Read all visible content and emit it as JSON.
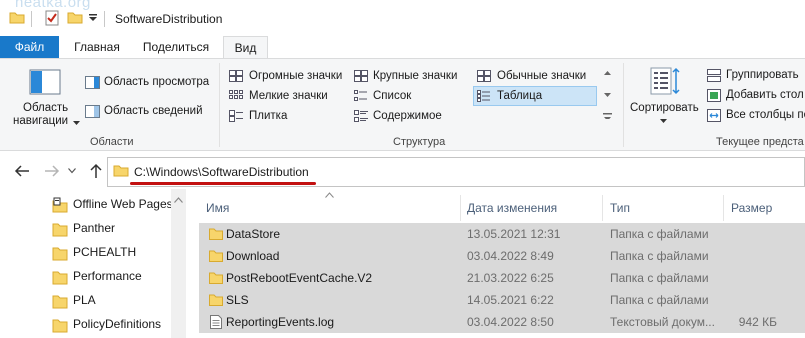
{
  "watermark": "neatka.org",
  "titlebar": {
    "title": "SoftwareDistribution"
  },
  "ribbon_tabs": [
    {
      "label": "Файл"
    },
    {
      "label": "Главная"
    },
    {
      "label": "Поделиться"
    },
    {
      "label": "Вид"
    }
  ],
  "panes_group": {
    "nav_pane": "Область навигации",
    "nav_pane_line1": "Область",
    "nav_pane_line2": "навигации",
    "preview": "Область просмотра",
    "details": "Область сведений",
    "label": "Области"
  },
  "layout_group": {
    "items": [
      "Огромные значки",
      "Крупные значки",
      "Обычные значки",
      "Мелкие значки",
      "Список",
      "Таблица",
      "Плитка",
      "Содержимое"
    ],
    "selected": "Таблица",
    "label": "Структура"
  },
  "view_group": {
    "sort": "Сортировать",
    "group_by": "Группировать",
    "add_columns": "Добавить стол",
    "size_columns": "Все столбцы по",
    "label": "Текущее предста"
  },
  "address": {
    "path": "C:\\Windows\\SoftwareDistribution"
  },
  "nav_pane_items": [
    "Offline Web Pages",
    "Panther",
    "PCHEALTH",
    "Performance",
    "PLA",
    "PolicyDefinitions"
  ],
  "columns": {
    "name": "Имя",
    "date": "Дата изменения",
    "type": "Тип",
    "size": "Размер"
  },
  "files": [
    {
      "name": "DataStore",
      "date": "13.05.2021 12:31",
      "type": "Папка с файлами",
      "size": "",
      "icon": "folder-icon"
    },
    {
      "name": "Download",
      "date": "03.04.2022 8:49",
      "type": "Папка с файлами",
      "size": "",
      "icon": "folder-icon"
    },
    {
      "name": "PostRebootEventCache.V2",
      "date": "21.03.2022 6:25",
      "type": "Папка с файлами",
      "size": "",
      "icon": "folder-icon"
    },
    {
      "name": "SLS",
      "date": "14.05.2021 6:22",
      "type": "Папка с файлами",
      "size": "",
      "icon": "folder-icon"
    },
    {
      "name": "ReportingEvents.log",
      "date": "03.04.2022 8:50",
      "type": "Текстовый докум...",
      "size": "942 КБ",
      "icon": "text-file-icon"
    }
  ],
  "colors": {
    "accent": "#1979ca",
    "selection": "#cce4f7",
    "row_highlight": "#d9d9d9",
    "folder": "#f7d56b",
    "underline": "#c21010"
  }
}
